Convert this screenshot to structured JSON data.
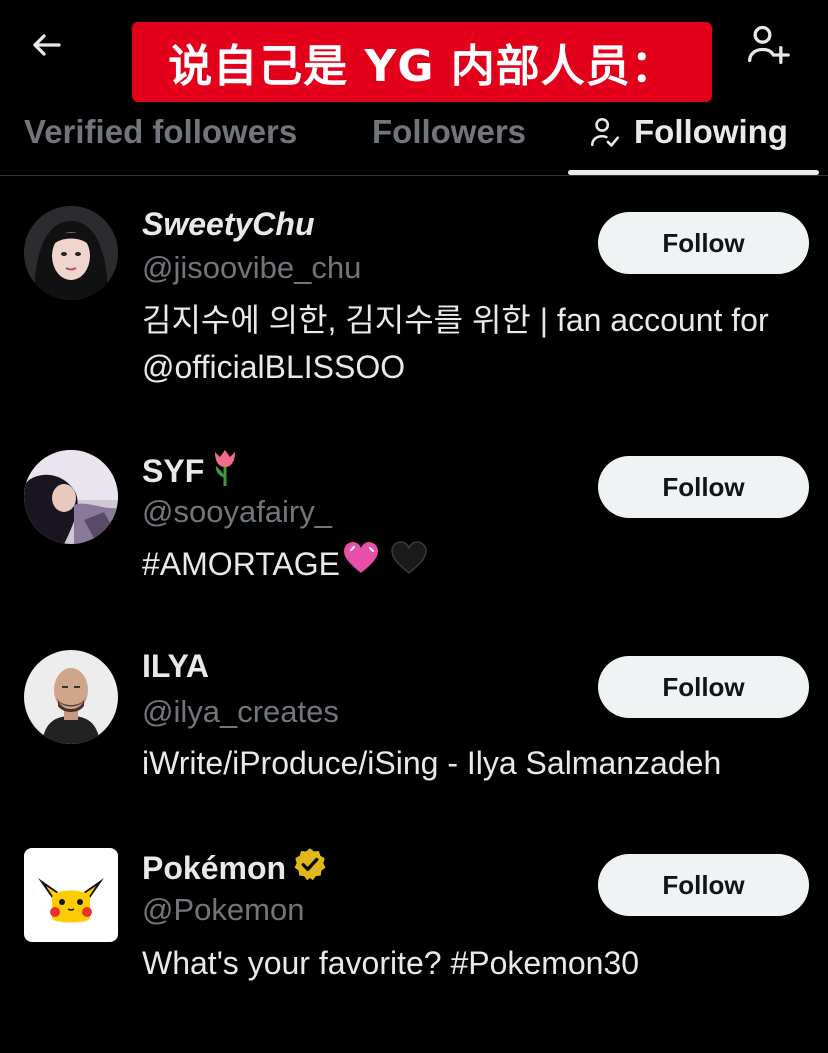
{
  "header": {
    "back_icon": "arrow-left-icon",
    "add_user_icon": "person-add-icon"
  },
  "banner": {
    "text": "说自己是 YG 内部人员：",
    "color": "#e3001b"
  },
  "tabs": [
    {
      "label": "Verified followers",
      "active": false
    },
    {
      "label": "Followers",
      "active": false
    },
    {
      "label": "Following",
      "active": true,
      "icon": "person-check-icon"
    }
  ],
  "users": [
    {
      "name": "SweetyChu",
      "handle": "@jisoovibe_chu",
      "bio": "김지수에 의한, 김지수를 위한 | fan account for @officialBLISSOO",
      "button": "Follow",
      "avatar": "portrait-avatar"
    },
    {
      "name": "SYF",
      "name_emoji": "tulip-emoji",
      "handle": "@sooyafairy_",
      "bio": "#AMORTAGE",
      "bio_emojis": [
        "pink-heart-emoji",
        "black-heart-emoji"
      ],
      "button": "Follow",
      "avatar": "photo-avatar"
    },
    {
      "name": "ILYA",
      "handle": "@ilya_creates",
      "bio": "iWrite/iProduce/iSing - Ilya Salmanzadeh",
      "button": "Follow",
      "avatar": "bald-man-avatar"
    },
    {
      "name": "Pokémon",
      "verified_badge": "gold-verified-badge-icon",
      "handle": "@Pokemon",
      "bio": "What's your favorite? #Pokemon30",
      "button": "Follow",
      "avatar": "pikachu-logo-avatar"
    }
  ]
}
